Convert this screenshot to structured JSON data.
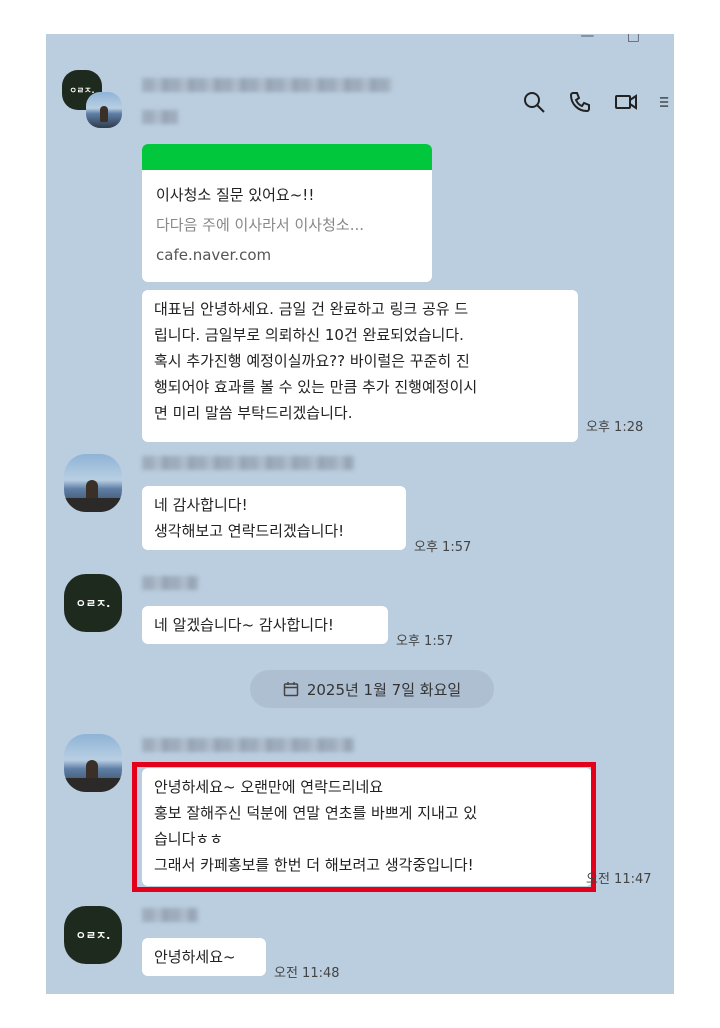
{
  "window": {
    "controls": [
      "—",
      "□"
    ]
  },
  "header": {
    "icons": [
      "search-icon",
      "phone-icon",
      "video-icon",
      "menu-icon"
    ]
  },
  "link_card": {
    "title": "이사청소 질문 있어요~!!",
    "desc": "다다음 주에 이사라서 이사청소...",
    "url": "cafe.naver.com",
    "accent": "#00c73c"
  },
  "messages": {
    "m1": {
      "text": "대표님 안녕하세요. 금일 건 완료하고 링크 공유 드\n립니다. 금일부로 의뢰하신 10건 완료되었습니다.\n혹시 추가진행 예정이실까요?? 바이럴은 꾸준히 진\n행되어야 효과를 볼 수 있는 만큼 추가 진행예정이시\n면 미리 말씀 부탁드리겠습니다.",
      "time": "오후 1:28"
    },
    "m2": {
      "text": "네 감사합니다!\n생각해보고 연락드리겠습니다!",
      "time": "오후 1:57"
    },
    "m3": {
      "text": "네 알겠습니다~ 감사합니다!",
      "time": "오후 1:57"
    },
    "m4": {
      "text": "안녕하세요~ 오랜만에 연락드리네요\n홍보 잘해주신 덕분에 연말 연초를 바쁘게 지내고 있\n습니다ㅎㅎ\n그래서 카페홍보를 한번 더 해보려고 생각중입니다!",
      "time": "오전 11:47"
    },
    "m5": {
      "text": "안녕하세요~",
      "time": "오전 11:48"
    }
  },
  "date_divider": "2025년 1월 7일 화요일",
  "logo_text": "ㅇㄹㅈ.",
  "colors": {
    "chat_bg": "#bacee0",
    "highlight": "#e4001b",
    "logo_bg": "#1f2a1f"
  }
}
